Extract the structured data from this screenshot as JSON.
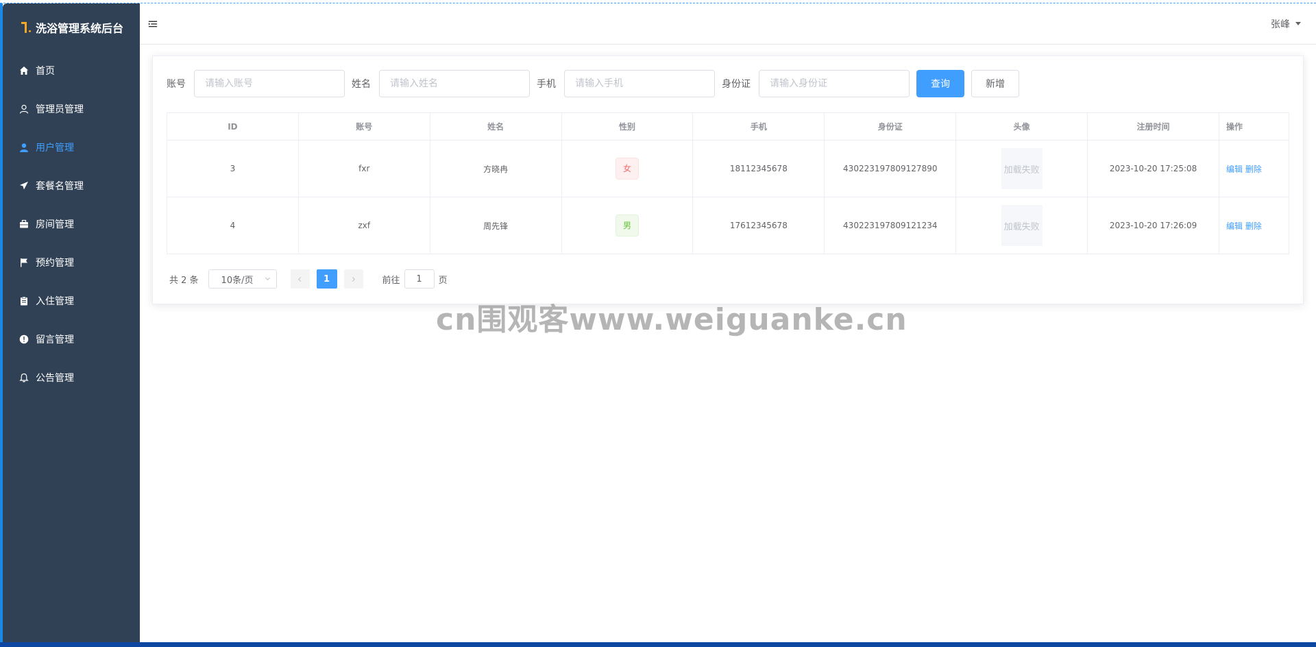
{
  "app": {
    "title": "洗浴管理系统后台"
  },
  "sidebar": {
    "items": [
      {
        "label": "首页",
        "icon": "home-icon"
      },
      {
        "label": "管理员管理",
        "icon": "user-outline-icon"
      },
      {
        "label": "用户管理",
        "icon": "user-filled-icon",
        "active": true
      },
      {
        "label": "套餐名管理",
        "icon": "paper-plane-icon"
      },
      {
        "label": "房间管理",
        "icon": "briefcase-icon"
      },
      {
        "label": "预约管理",
        "icon": "flag-icon"
      },
      {
        "label": "入住管理",
        "icon": "clipboard-icon"
      },
      {
        "label": "留言管理",
        "icon": "warning-icon"
      },
      {
        "label": "公告管理",
        "icon": "bell-icon"
      }
    ]
  },
  "header": {
    "username": "张峰"
  },
  "search": {
    "account_label": "账号",
    "account_placeholder": "请输入账号",
    "name_label": "姓名",
    "name_placeholder": "请输入姓名",
    "phone_label": "手机",
    "phone_placeholder": "请输入手机",
    "idcard_label": "身份证",
    "idcard_placeholder": "请输入身份证",
    "query_button": "查询",
    "add_button": "新增"
  },
  "table": {
    "columns": [
      "ID",
      "账号",
      "姓名",
      "性别",
      "手机",
      "身份证",
      "头像",
      "注册时间",
      "操作"
    ],
    "rows": [
      {
        "id": "3",
        "account": "fxr",
        "name": "方晓冉",
        "gender": "女",
        "phone": "18112345678",
        "idcard": "430223197809127890",
        "avatar": "加载失败",
        "registered": "2023-10-20 17:25:08",
        "edit": "编辑",
        "delete": "删除"
      },
      {
        "id": "4",
        "account": "zxf",
        "name": "周先锋",
        "gender": "男",
        "phone": "17612345678",
        "idcard": "430223197809121234",
        "avatar": "加载失败",
        "registered": "2023-10-20 17:26:09",
        "edit": "编辑",
        "delete": "删除"
      }
    ]
  },
  "pagination": {
    "total": "共 2 条",
    "page_size": "10条/页",
    "current_page": "1",
    "goto_label": "前往",
    "goto_value": "1",
    "page_suffix": "页"
  },
  "watermark": "cn围观客www.weiguanke.cn",
  "colors": {
    "sidebar_bg": "#304156",
    "accent": "#409eff",
    "female": "#f56c6c",
    "male": "#67c23a"
  }
}
